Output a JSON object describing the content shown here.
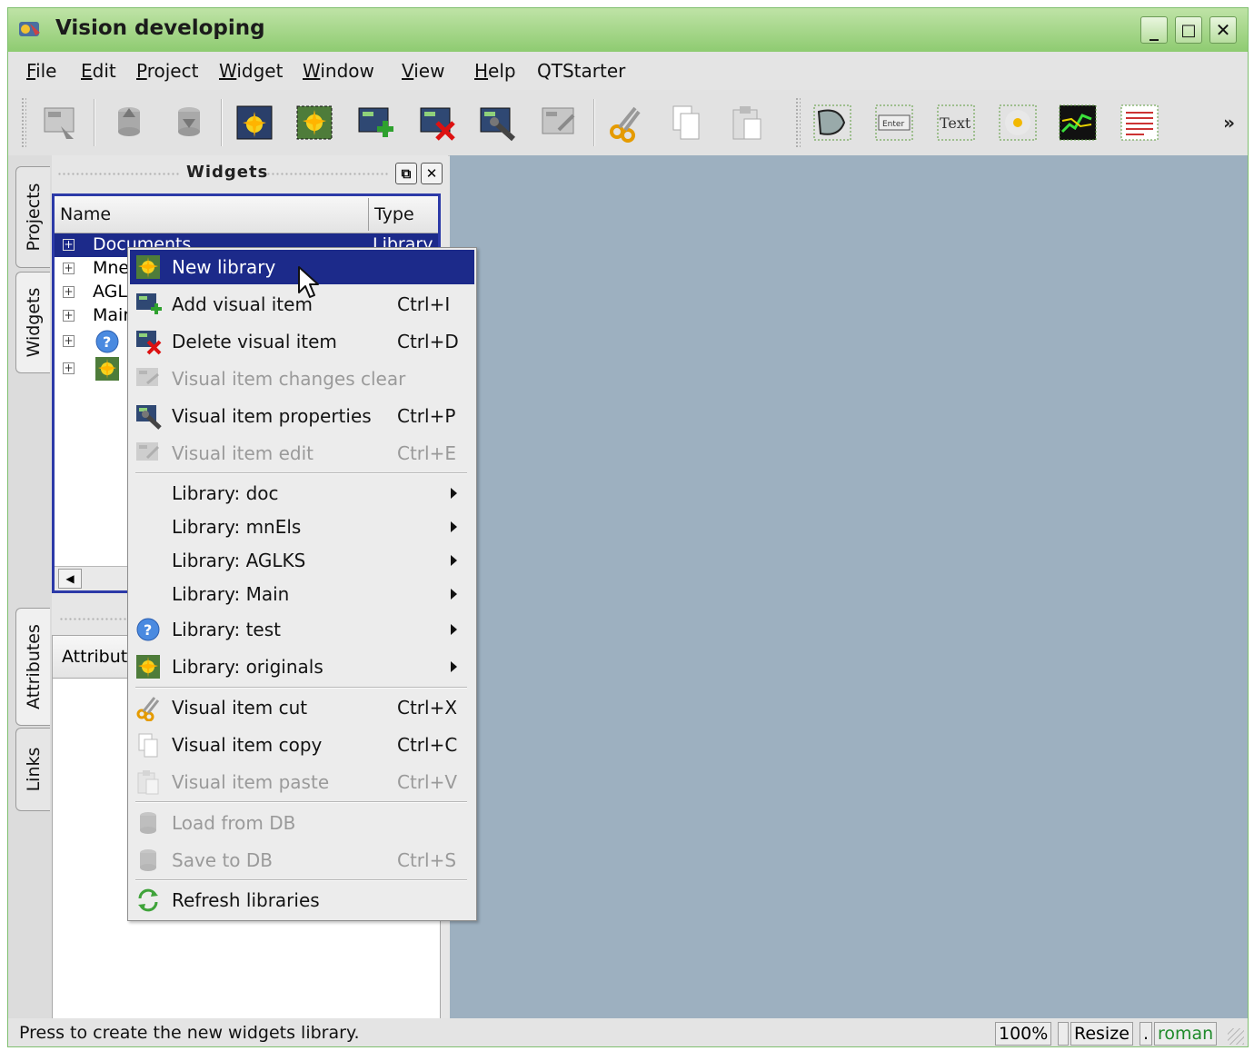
{
  "window": {
    "title": "Vision developing",
    "min_label": "_",
    "max_label": "□",
    "close_label": "✕"
  },
  "menubar": [
    {
      "label": "File",
      "u": "F",
      "rest": "ile"
    },
    {
      "label": "Edit",
      "u": "E",
      "rest": "dit"
    },
    {
      "label": "Project",
      "u": "P",
      "rest": "roject"
    },
    {
      "label": "Widget",
      "u": "W",
      "rest": "idget"
    },
    {
      "label": "Window",
      "u": "W",
      "rest": "indow"
    },
    {
      "label": "View",
      "u": "V",
      "rest": "iew"
    },
    {
      "label": "Help",
      "u": "H",
      "rest": "elp"
    },
    {
      "label": "QTStarter",
      "u": "",
      "rest": "QTStarter"
    }
  ],
  "toolbar": {
    "overflow": "»",
    "buttons": [
      "visual-item-edit-icon",
      "load-db-icon",
      "save-db-icon",
      "new-library-icon",
      "new-library-2-icon",
      "add-visual-item-icon",
      "delete-visual-item-icon",
      "visual-item-properties-icon",
      "visual-item-changes-icon",
      "cut-icon",
      "copy-icon",
      "paste-icon",
      "elfigure-icon",
      "formel-icon",
      "text-icon",
      "media-icon",
      "diagram-icon",
      "protocol-icon"
    ],
    "formel_text": "Enter",
    "text_text": "Text"
  },
  "left_tabs": [
    "Projects",
    "Widgets",
    "Attributes",
    "Links"
  ],
  "widgets_dock": {
    "title": "Widgets",
    "columns": [
      "Name",
      "Type"
    ],
    "rows": [
      {
        "name": "Documents",
        "type": "Library",
        "selected": true
      },
      {
        "name": "Mne",
        "type": ""
      },
      {
        "name": "AGL",
        "type": ""
      },
      {
        "name": "Mair",
        "type": ""
      },
      {
        "name": "",
        "type": "",
        "icon": "help"
      },
      {
        "name": "",
        "type": "",
        "icon": "originals"
      }
    ]
  },
  "attributes_dock": {
    "column": "Attribute"
  },
  "context_menu": [
    {
      "label": "New library",
      "shortcut": "",
      "icon": "new-library-icon",
      "highlight": true
    },
    {
      "label": "Add visual item",
      "shortcut": "Ctrl+I",
      "icon": "add-visual-item-icon"
    },
    {
      "label": "Delete visual item",
      "shortcut": "Ctrl+D",
      "icon": "delete-visual-item-icon"
    },
    {
      "label": "Visual item changes clear",
      "shortcut": "",
      "icon": "changes-clear-icon",
      "disabled": true
    },
    {
      "label": "Visual item properties",
      "shortcut": "Ctrl+P",
      "icon": "properties-icon"
    },
    {
      "label": "Visual item edit",
      "shortcut": "Ctrl+E",
      "icon": "edit-icon",
      "disabled": true
    },
    {
      "label": "Library: doc",
      "submenu": true
    },
    {
      "label": "Library: mnEls",
      "submenu": true
    },
    {
      "label": "Library: AGLKS",
      "submenu": true
    },
    {
      "label": "Library: Main",
      "submenu": true
    },
    {
      "label": "Library: test",
      "submenu": true,
      "icon": "help-icon"
    },
    {
      "label": "Library: originals",
      "submenu": true,
      "icon": "originals-icon"
    },
    {
      "label": "Visual item cut",
      "shortcut": "Ctrl+X",
      "icon": "cut-icon"
    },
    {
      "label": "Visual item copy",
      "shortcut": "Ctrl+C",
      "icon": "copy-icon"
    },
    {
      "label": "Visual item paste",
      "shortcut": "Ctrl+V",
      "icon": "paste-icon",
      "disabled": true
    },
    {
      "label": "Load from DB",
      "shortcut": "",
      "icon": "load-db-icon",
      "disabled": true
    },
    {
      "label": "Save to DB",
      "shortcut": "Ctrl+S",
      "icon": "save-db-icon",
      "disabled": true
    },
    {
      "label": "Refresh libraries",
      "shortcut": "",
      "icon": "refresh-icon"
    }
  ],
  "statusbar": {
    "message": "Press to create the new widgets library.",
    "zoom": "100%",
    "mode": "Resize",
    "dot": ".",
    "user": "roman"
  },
  "colors": {
    "titlebar": "#8ecb71",
    "selection": "#1c2a8a",
    "workspace": "#9db0c0",
    "user": "#1f8a2a"
  }
}
